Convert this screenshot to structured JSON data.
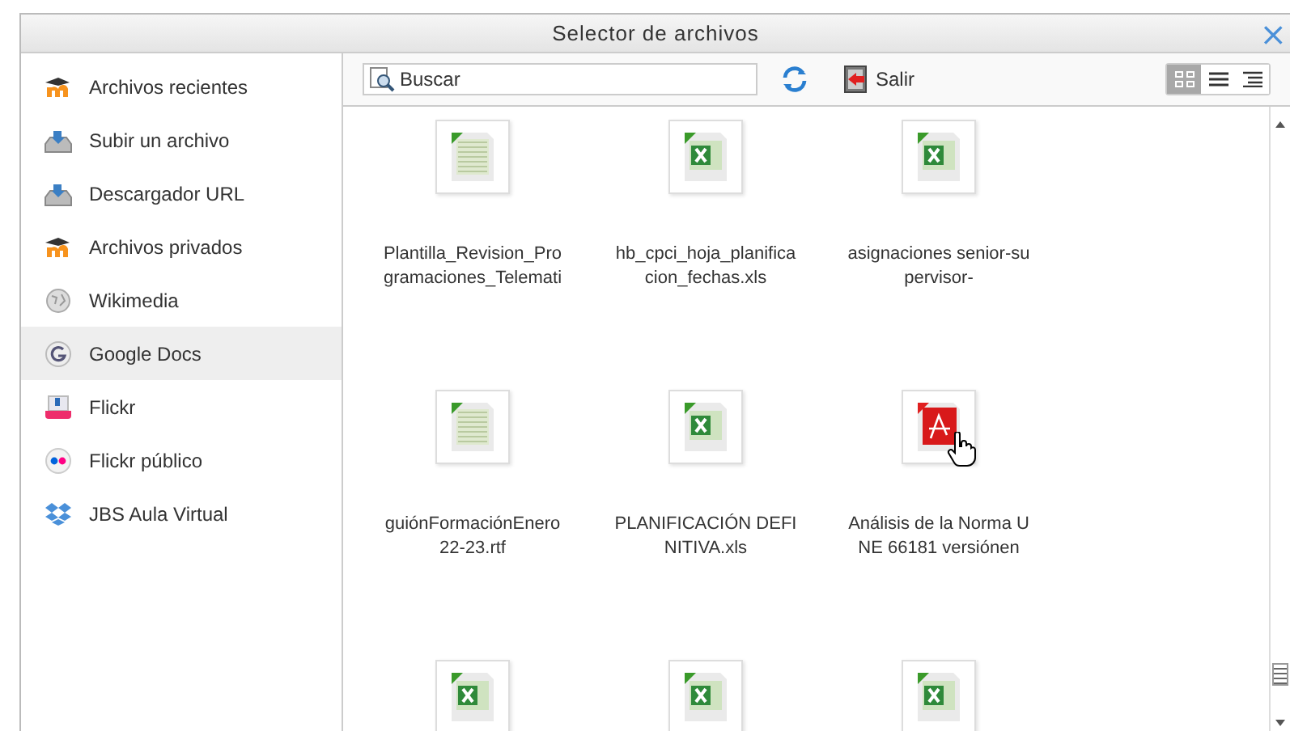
{
  "window": {
    "title": "Selector de archivos",
    "close": "×"
  },
  "sidebar": {
    "items": [
      {
        "kind": "moodle",
        "label": "Archivos recientes",
        "selected": false
      },
      {
        "kind": "upload",
        "label": "Subir un archivo",
        "selected": false
      },
      {
        "kind": "upload",
        "label": "Descargador URL",
        "selected": false
      },
      {
        "kind": "moodle",
        "label": "Archivos privados",
        "selected": false
      },
      {
        "kind": "wiki",
        "label": "Wikimedia",
        "selected": false
      },
      {
        "kind": "google",
        "label": "Google Docs",
        "selected": true
      },
      {
        "kind": "flickr",
        "label": "Flickr",
        "selected": false
      },
      {
        "kind": "flickr-public",
        "label": "Flickr público",
        "selected": false
      },
      {
        "kind": "dropbox",
        "label": "JBS Aula Virtual",
        "selected": false
      }
    ]
  },
  "toolbar": {
    "search": {
      "placeholder": "Buscar"
    },
    "logout": "Salir",
    "views": [
      {
        "kind": "icons",
        "selected": true
      },
      {
        "kind": "list",
        "selected": false
      },
      {
        "kind": "tree",
        "selected": false
      }
    ]
  },
  "files": [
    {
      "kind": "text",
      "name": "Plantilla_Revision_Programaciones_Telemati"
    },
    {
      "kind": "xls",
      "name": "hb_cpci_hoja_planificacion_fechas.xls"
    },
    {
      "kind": "xls",
      "name": "asignaciones senior-supervisor-"
    },
    {
      "kind": "text",
      "name": "guiónFormaciónEnero 22-23.rtf"
    },
    {
      "kind": "xls",
      "name": "PLANIFICACIÓN DEFINITIVA.xls"
    },
    {
      "kind": "pdf",
      "name": "Análisis de la Norma UNE 66181 versiónen",
      "hovered": true
    },
    {
      "kind": "xls"
    },
    {
      "kind": "xls"
    },
    {
      "kind": "xls"
    }
  ]
}
